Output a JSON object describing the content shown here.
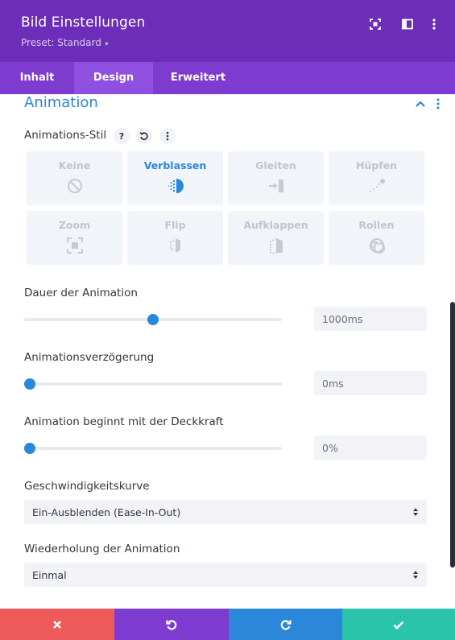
{
  "header": {
    "title": "Bild Einstellungen",
    "preset": "Preset: Standard"
  },
  "tabs": [
    {
      "label": "Inhalt"
    },
    {
      "label": "Design"
    },
    {
      "label": "Erweitert"
    }
  ],
  "section": {
    "title": "Animation"
  },
  "animation_style": {
    "label": "Animations-Stil",
    "options": [
      {
        "label": "Keine",
        "icon": "none-icon",
        "selected": false
      },
      {
        "label": "Verblassen",
        "icon": "fade-icon",
        "selected": true
      },
      {
        "label": "Gleiten",
        "icon": "slide-icon",
        "selected": false
      },
      {
        "label": "Hüpfen",
        "icon": "bounce-icon",
        "selected": false
      },
      {
        "label": "Zoom",
        "icon": "zoom-icon",
        "selected": false
      },
      {
        "label": "Flip",
        "icon": "flip-icon",
        "selected": false
      },
      {
        "label": "Aufklappen",
        "icon": "fold-icon",
        "selected": false
      },
      {
        "label": "Rollen",
        "icon": "roll-icon",
        "selected": false
      }
    ]
  },
  "duration": {
    "label": "Dauer der Animation",
    "value": "1000ms",
    "slider_fraction": 0.5
  },
  "delay": {
    "label": "Animationsverzögerung",
    "value": "0ms",
    "slider_fraction": 0
  },
  "opacity": {
    "label": "Animation beginnt mit der Deckkraft",
    "value": "0%",
    "slider_fraction": 0
  },
  "speed_curve": {
    "label": "Geschwindigkeitskurve",
    "value": "Ein-Ausblenden (Ease-In-Out)"
  },
  "repeat": {
    "label": "Wiederholung der Animation",
    "value": "Einmal"
  },
  "colors": {
    "header": "#6c2eb9",
    "tabs": "#7d3bcf",
    "accent": "#2b87da",
    "cancel": "#ef5a5a",
    "undo": "#7d3bcf",
    "redo": "#2b87da",
    "save": "#29c4a9"
  }
}
